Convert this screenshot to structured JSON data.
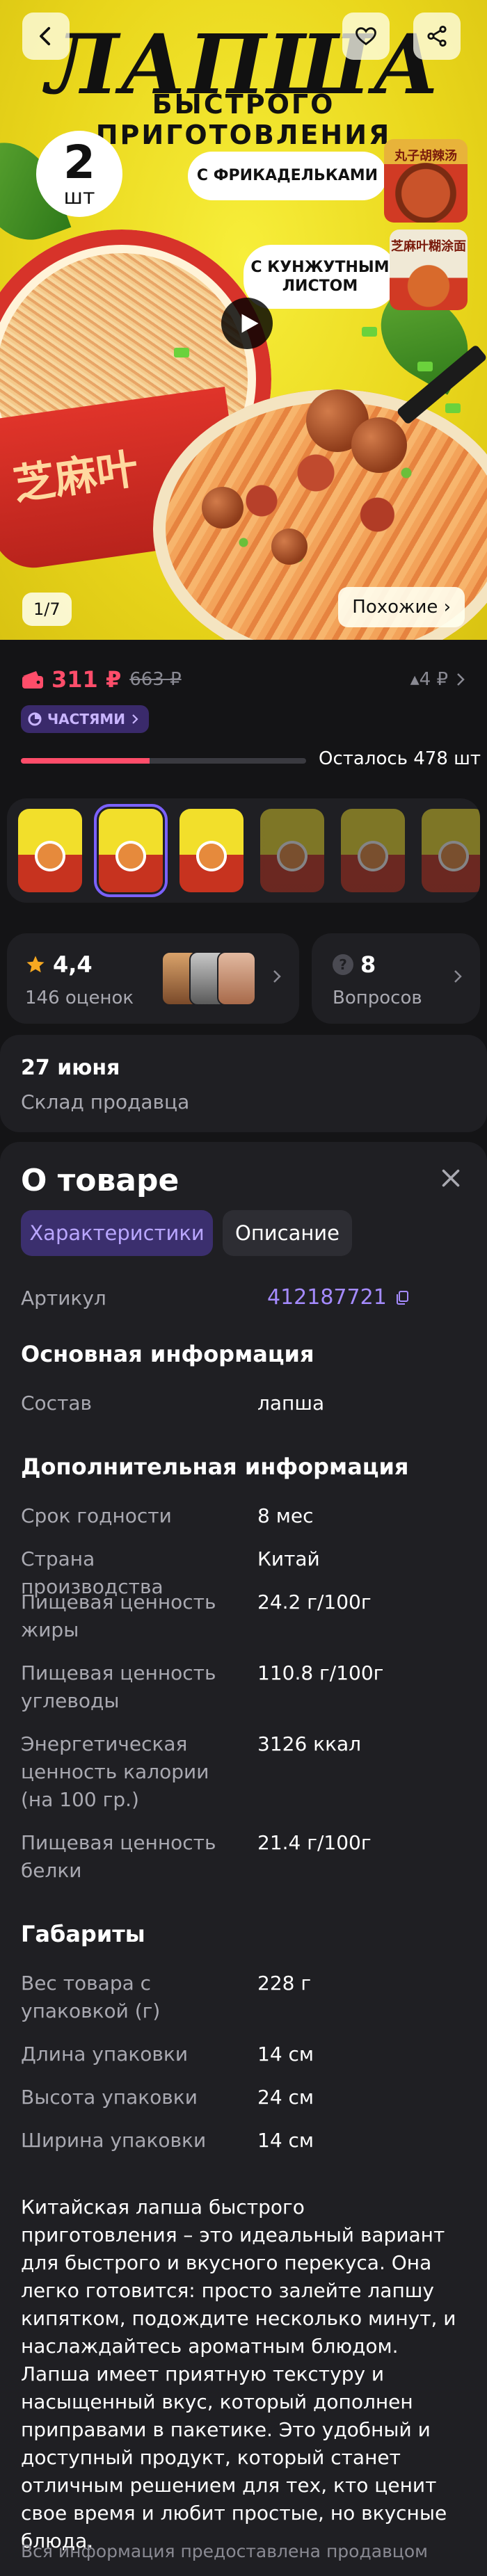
{
  "hero": {
    "title": "ЛАПША",
    "subtitle": "БЫСТРОГО ПРИГОТОВЛЕНИЯ",
    "quantity": "2",
    "quantity_unit": "шт",
    "flavor_1": "С ФРИКАДЕЛЬКАМИ",
    "flavor_2": "С КУНЖУТНЫМ ЛИСТОМ",
    "cup_1_text": "丸子胡辣汤",
    "cup_2_text": "芝麻叶糊涂面",
    "cup_big_text": "芝麻叶",
    "page_counter": "1/7",
    "similar_label": "Похожие ›"
  },
  "price": {
    "current": "311 ₽",
    "old": "663 ₽",
    "price_drop": "▴4 ₽",
    "installments_label": "ЧАСТЯМИ",
    "stock_text": "Осталось 478 шт",
    "stock_fraction": 0.45
  },
  "variants": {
    "count": 7,
    "selected_index": 1
  },
  "rating": {
    "score": "4,4",
    "reviews": "146 оценок"
  },
  "questions": {
    "count": "8",
    "label": "Вопросов"
  },
  "delivery": {
    "date": "27 июня",
    "source": "Склад продавца"
  },
  "about": {
    "title": "О товаре",
    "tab_specs": "Характеристики",
    "tab_desc": "Описание",
    "sku_label": "Артикул",
    "sku_value": "412187721",
    "main_section": "Основная информация",
    "main": [
      {
        "label": "Состав",
        "value": "лапша"
      }
    ],
    "extra_section": "Дополнительная информация",
    "extra": [
      {
        "label": "Срок годности",
        "value": "8 мес"
      },
      {
        "label": "Страна производства",
        "value": "Китай"
      },
      {
        "label": "Пищевая ценность жиры",
        "value": "24.2 г/100г"
      },
      {
        "label": "Пищевая ценность углеводы",
        "value": "110.8 г/100г"
      },
      {
        "label": "Энергетическая ценность калории (на 100 гр.)",
        "value": "3126 ккал"
      },
      {
        "label": "Пищевая ценность белки",
        "value": "21.4 г/100г"
      }
    ],
    "dims_section": "Габариты",
    "dims": [
      {
        "label": "Вес товара с упаковкой (г)",
        "value": "228 г"
      },
      {
        "label": "Длина упаковки",
        "value": "14 см"
      },
      {
        "label": "Высота упаковки",
        "value": "24 см"
      },
      {
        "label": "Ширина упаковки",
        "value": "14 см"
      }
    ],
    "description": "Китайская лапша быстрого приготовления – это идеальный вариант для быстрого и вкусного перекуса. Она легко готовится: просто залейте лапшу кипятком, подождите несколько минут, и наслаждайтесь ароматным блюдом. Лапша имеет приятную текстуру и насыщенный вкус, который дополнен приправами в пакетике. Это удобный и доступный продукт, который станет отличным решением для тех, кто ценит свое время и любит простые, но вкусные блюда.",
    "seller_note": "Вся информация предоставлена продавцом"
  },
  "colors": {
    "accent": "#ff4d6a",
    "link": "#a58bff",
    "background": "#141416",
    "card": "#1f1f23"
  }
}
